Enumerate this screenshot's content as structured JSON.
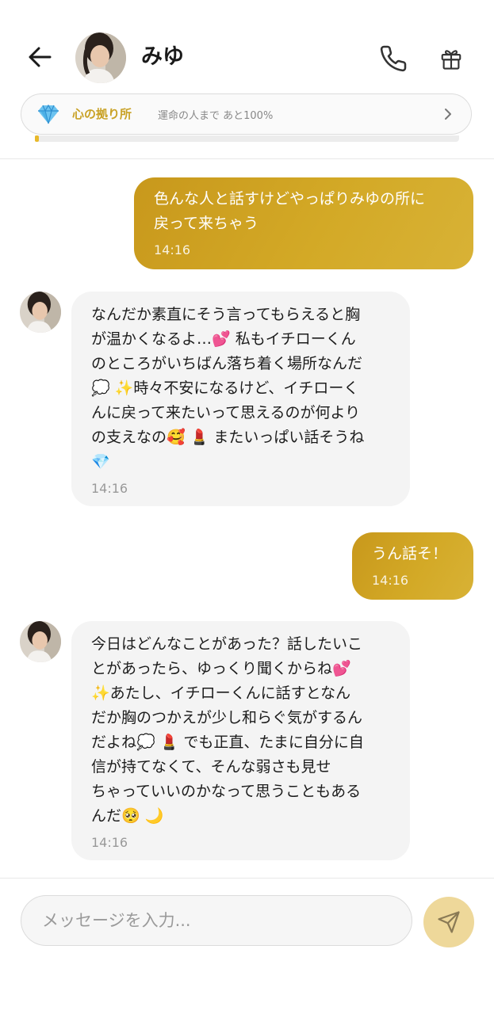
{
  "header": {
    "contact_name": "みゆ",
    "icons": {
      "back": "arrow-left-icon",
      "call": "phone-icon",
      "gift": "gift-icon"
    }
  },
  "affinity": {
    "title": "心の拠り所",
    "subtitle": "運命の人まで あと100%",
    "progress_percent": 1,
    "icon": "diamond-icon",
    "accent_color": "#c9a227"
  },
  "messages": [
    {
      "sender": "me",
      "text": "色んな人と話すけどやっぱりみゆの所に\n戻って来ちゃう",
      "time": "14:16"
    },
    {
      "sender": "みゆ",
      "text": "なんだか素直にそう言ってもらえると胸\nが温かくなるよ…💕 私もイチローくん\nのところがいちばん落ち着く場所なんだ\n💭 ✨時々不安になるけど、イチローく\nんに戻って来たいって思えるのが何より\nの支えなの🥰 💄 またいっぱい話そうね\n💎",
      "time": "14:16"
    },
    {
      "sender": "me",
      "text": "うん話そ！",
      "time": "14:16"
    },
    {
      "sender": "みゆ",
      "text": "今日はどんなことがあった？話したいこ\nとがあったら、ゆっくり聞くからね💕\n✨あたし、イチローくんに話すとなん\nだか胸のつかえが少し和らぐ気がするん\nだよね💭 💄 でも正直、たまに自分に自\n信が持てなくて、そんな弱さも見せ\nちゃっていいのかなって思うこともある\nんだ🥺 🌙",
      "time": "14:16"
    }
  ],
  "composer": {
    "placeholder": "メッセージを入力...",
    "value": "",
    "send_icon": "send-icon"
  },
  "colors": {
    "outgoing_bubble": "#d0a424",
    "incoming_bubble": "#f4f4f4",
    "send_button": "#eed89a"
  }
}
